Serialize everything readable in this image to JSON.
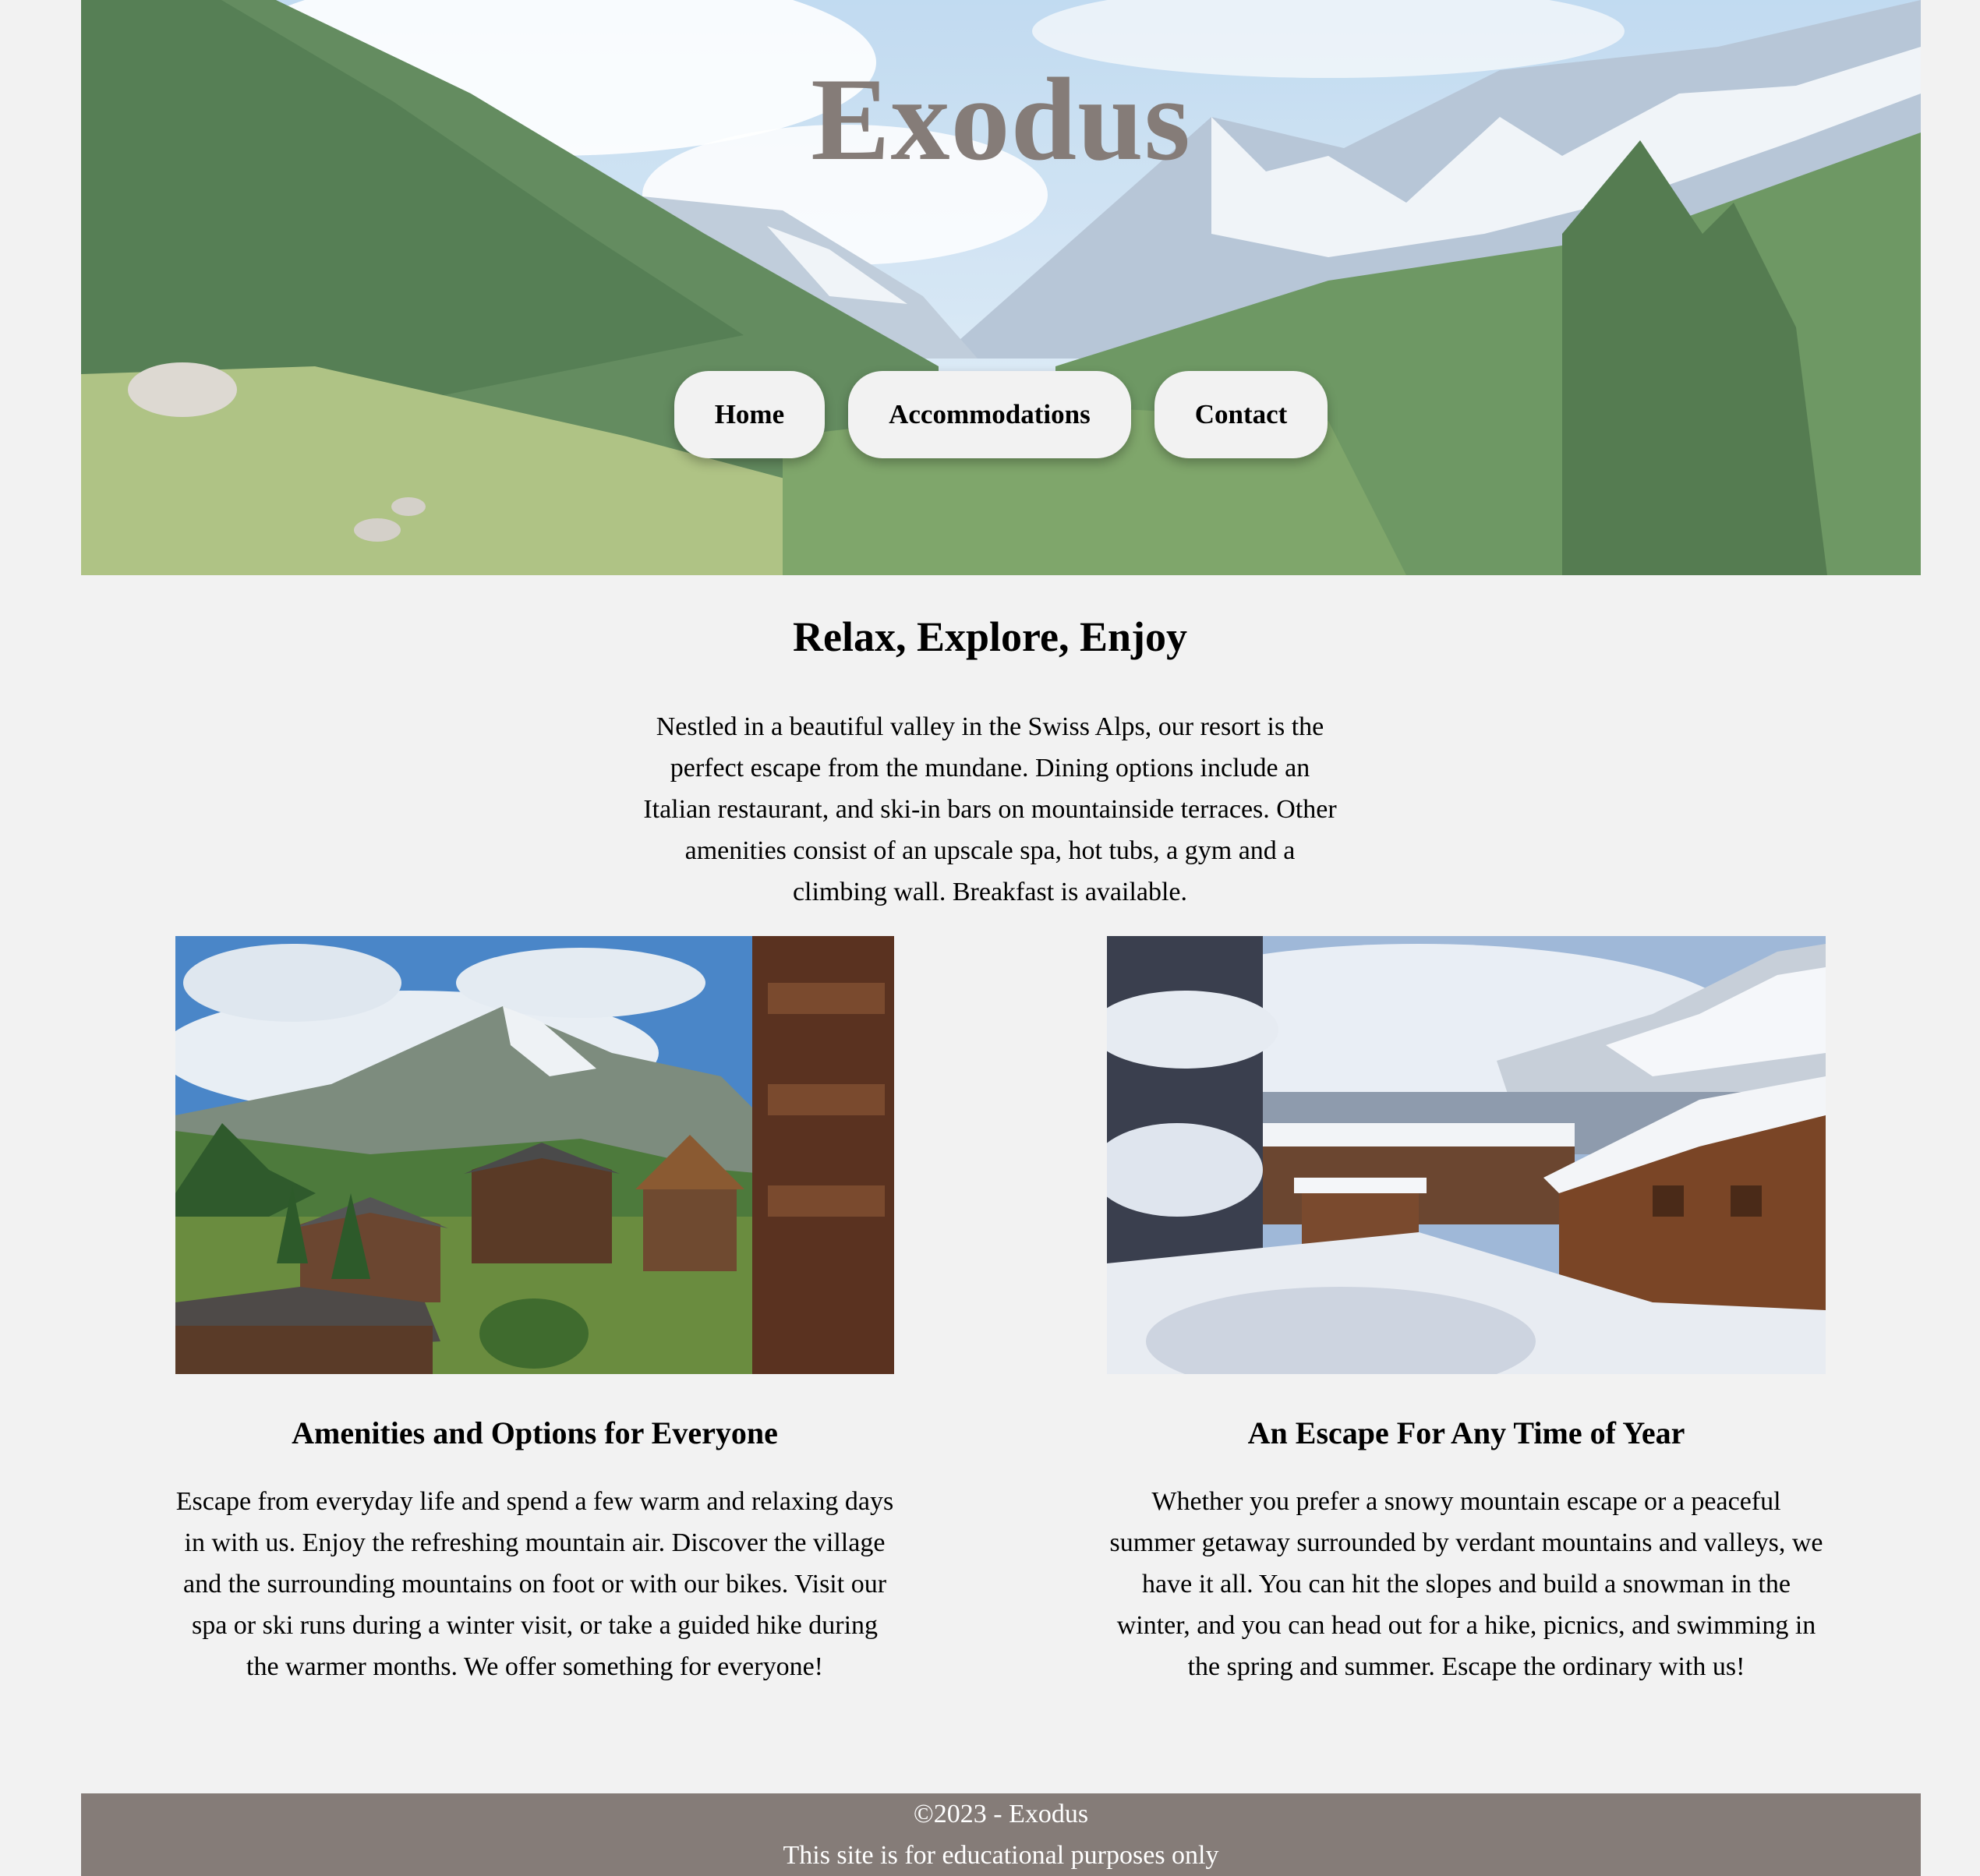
{
  "header": {
    "site_title": "Exodus",
    "nav": [
      {
        "label": "Home"
      },
      {
        "label": "Accommodations"
      },
      {
        "label": "Contact"
      }
    ]
  },
  "intro": {
    "title": "Relax, Explore, Enjoy",
    "text": "Nestled in a beautiful valley in the Swiss Alps, our resort is the perfect escape from the mundane. Dining options include an Italian restaurant, and ski-in bars on mountainside terraces. Other amenities consist of an upscale spa, hot tubs, a gym and a climbing wall. Breakfast is available."
  },
  "features": [
    {
      "title": "Amenities and Options for Everyone",
      "text": "Escape from everyday life and spend a few warm and relaxing days in with us. Enjoy the refreshing mountain air. Discover the village and the surrounding mountains on foot or with our bikes. Visit our spa or ski runs during a winter visit, or take a guided hike during the warmer months. We offer something for everyone!"
    },
    {
      "title": "An Escape For Any Time of Year",
      "text": "Whether you prefer a snowy mountain escape or a peaceful summer getaway surrounded by verdant mountains and valleys, we have it all. You can hit the slopes and build a snowman in the winter, and you can head out for a hike, picnics, and swimming in the spring and summer. Escape the ordinary with us!"
    }
  ],
  "footer": {
    "copyright": "©2023 - Exodus",
    "note": "This site is for educational purposes only"
  },
  "colors": {
    "page_background": "#f2f2f2",
    "title_color": "#857c78",
    "footer_background": "#857c78",
    "nav_button_background": "#f2f2f2"
  }
}
